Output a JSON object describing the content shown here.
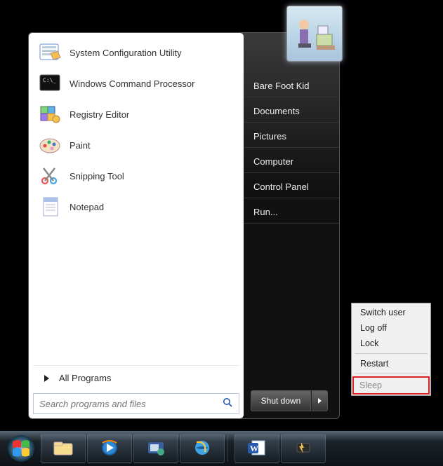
{
  "programs": [
    {
      "label": "System Configuration Utility",
      "icon": "msconfig"
    },
    {
      "label": "Windows Command Processor",
      "icon": "cmd"
    },
    {
      "label": "Registry Editor",
      "icon": "regedit"
    },
    {
      "label": "Paint",
      "icon": "paint"
    },
    {
      "label": "Snipping Tool",
      "icon": "snip"
    },
    {
      "label": "Notepad",
      "icon": "notepad"
    }
  ],
  "all_programs": "All Programs",
  "search": {
    "placeholder": "Search programs and files"
  },
  "right_items": [
    "Bare Foot Kid",
    "Documents",
    "Pictures",
    "Computer",
    "Control Panel",
    "Run..."
  ],
  "shutdown": {
    "label": "Shut down"
  },
  "shutdown_menu": {
    "group1": [
      "Switch user",
      "Log off",
      "Lock"
    ],
    "group2": [
      "Restart"
    ],
    "highlighted": "Sleep"
  },
  "taskbar_icons": [
    "explorer",
    "wmp",
    "unknown",
    "ie",
    "word",
    "power"
  ]
}
